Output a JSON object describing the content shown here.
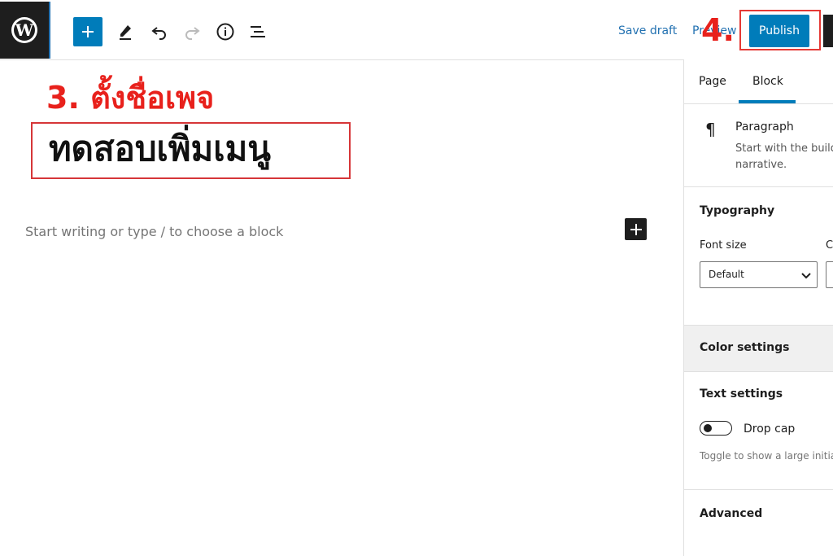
{
  "toolbar": {
    "logo_icon": "wordpress-icon",
    "add_icon": "plus-icon",
    "tools_icon": "pencil-icon",
    "undo_icon": "undo-icon",
    "redo_icon": "redo-icon",
    "info_icon": "info-icon",
    "outline_icon": "list-view-icon",
    "save_draft": "Save draft",
    "preview": "Preview",
    "publish": "Publish",
    "accent": "#007cba"
  },
  "annotations": {
    "step3": "3. ตั้งชื่อเพจ",
    "step4": "4.",
    "highlight_color": "#e8211c"
  },
  "editor": {
    "title": "ทดสอบเพิ่มเมนู",
    "placeholder": "Start writing or type / to choose a block"
  },
  "sidebar": {
    "tabs": [
      "Page",
      "Block"
    ],
    "active_tab": "Block",
    "block": {
      "icon": "paragraph-icon",
      "name": "Paragraph",
      "description_line1": "Start with the build",
      "description_line2": "narrative."
    },
    "typography": {
      "title": "Typography",
      "font_size_label": "Font size",
      "second_label": "C",
      "font_size_value": "Default"
    },
    "color_settings": "Color settings",
    "text_settings": {
      "title": "Text settings",
      "drop_cap_label": "Drop cap",
      "help": "Toggle to show a large initia"
    },
    "advanced": "Advanced"
  }
}
